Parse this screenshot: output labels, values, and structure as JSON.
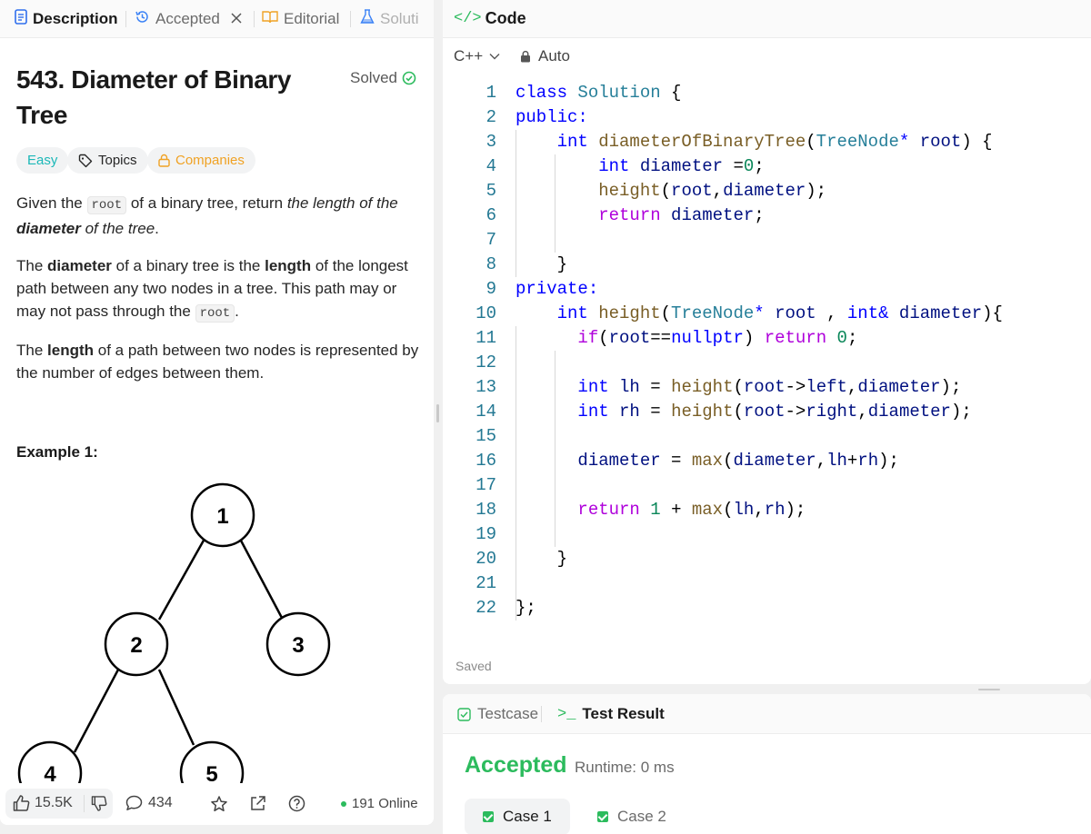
{
  "left_tabs": [
    {
      "label": "Description"
    },
    {
      "label": "Accepted"
    },
    {
      "label": "Editorial"
    },
    {
      "label": "Soluti"
    }
  ],
  "problem": {
    "title": "543. Diameter of Binary Tree",
    "status": "Solved",
    "chips": {
      "difficulty": "Easy",
      "topics": "Topics",
      "companies": "Companies"
    },
    "para1": {
      "t1": "Given the ",
      "code": "root",
      "t2": " of a binary tree, return ",
      "i1": "the length of the ",
      "bi": "diameter",
      "i2": " of the tree",
      "t3": "."
    },
    "para2": {
      "t1": "The ",
      "b1": "diameter",
      "t2": " of a binary tree is the ",
      "b2": "length",
      "t3": " of the longest path between any two nodes in a tree. This path may or may not pass through the ",
      "code": "root",
      "t4": "."
    },
    "para3": {
      "t1": "The ",
      "b1": "length",
      "t2": " of a path between two nodes is represented by the number of edges between them."
    },
    "example_title": "Example 1:",
    "tree_nodes": [
      "1",
      "2",
      "3",
      "4",
      "5"
    ]
  },
  "bottom_bar": {
    "likes": "15.5K",
    "comments": "434",
    "online": "191 Online"
  },
  "code_panel": {
    "title": "Code",
    "language": "C++",
    "mode": "Auto",
    "status": "Saved",
    "line_numbers": [
      "1",
      "2",
      "3",
      "4",
      "5",
      "6",
      "7",
      "8",
      "9",
      "10",
      "11",
      "12",
      "13",
      "14",
      "15",
      "16",
      "17",
      "18",
      "19",
      "20",
      "21",
      "22"
    ],
    "lines": [
      [
        [
          "k-blue",
          "class "
        ],
        [
          "k-type",
          "Solution"
        ],
        [
          "k-plain",
          " {"
        ]
      ],
      [
        [
          "k-blue",
          "public:"
        ]
      ],
      [
        [
          "k-plain",
          "    "
        ],
        [
          "k-blue",
          "int "
        ],
        [
          "k-fn",
          "diameterOfBinaryTree"
        ],
        [
          "k-plain",
          "("
        ],
        [
          "k-type",
          "TreeNode"
        ],
        [
          "k-blue",
          "* "
        ],
        [
          "k-var",
          "root"
        ],
        [
          "k-plain",
          ") {"
        ]
      ],
      [
        [
          "k-plain",
          "        "
        ],
        [
          "k-blue",
          "int "
        ],
        [
          "k-var",
          "diameter "
        ],
        [
          "k-plain",
          "="
        ],
        [
          "k-num",
          "0"
        ],
        [
          "k-plain",
          ";"
        ]
      ],
      [
        [
          "k-plain",
          "        "
        ],
        [
          "k-fn",
          "height"
        ],
        [
          "k-plain",
          "("
        ],
        [
          "k-var",
          "root"
        ],
        [
          "k-plain",
          ","
        ],
        [
          "k-var",
          "diameter"
        ],
        [
          "k-plain",
          ");"
        ]
      ],
      [
        [
          "k-plain",
          "        "
        ],
        [
          "k-purple",
          "return "
        ],
        [
          "k-var",
          "diameter"
        ],
        [
          "k-plain",
          ";"
        ]
      ],
      [],
      [
        [
          "k-plain",
          "    }"
        ]
      ],
      [
        [
          "k-blue",
          "private:"
        ]
      ],
      [
        [
          "k-plain",
          "    "
        ],
        [
          "k-blue",
          "int "
        ],
        [
          "k-fn",
          "height"
        ],
        [
          "k-plain",
          "("
        ],
        [
          "k-type",
          "TreeNode"
        ],
        [
          "k-blue",
          "* "
        ],
        [
          "k-var",
          "root "
        ],
        [
          "k-plain",
          ", "
        ],
        [
          "k-blue",
          "int& "
        ],
        [
          "k-var",
          "diameter"
        ],
        [
          "k-plain",
          "){"
        ]
      ],
      [
        [
          "k-plain",
          "      "
        ],
        [
          "k-purple",
          "if"
        ],
        [
          "k-plain",
          "("
        ],
        [
          "k-var",
          "root"
        ],
        [
          "k-plain",
          "=="
        ],
        [
          "k-blue",
          "nullptr"
        ],
        [
          "k-plain",
          ") "
        ],
        [
          "k-purple",
          "return "
        ],
        [
          "k-num",
          "0"
        ],
        [
          "k-plain",
          ";"
        ]
      ],
      [],
      [
        [
          "k-plain",
          "      "
        ],
        [
          "k-blue",
          "int "
        ],
        [
          "k-var",
          "lh "
        ],
        [
          "k-plain",
          "= "
        ],
        [
          "k-fn",
          "height"
        ],
        [
          "k-plain",
          "("
        ],
        [
          "k-var",
          "root"
        ],
        [
          "k-plain",
          "->"
        ],
        [
          "k-var",
          "left"
        ],
        [
          "k-plain",
          ","
        ],
        [
          "k-var",
          "diameter"
        ],
        [
          "k-plain",
          ");"
        ]
      ],
      [
        [
          "k-plain",
          "      "
        ],
        [
          "k-blue",
          "int "
        ],
        [
          "k-var",
          "rh "
        ],
        [
          "k-plain",
          "= "
        ],
        [
          "k-fn",
          "height"
        ],
        [
          "k-plain",
          "("
        ],
        [
          "k-var",
          "root"
        ],
        [
          "k-plain",
          "->"
        ],
        [
          "k-var",
          "right"
        ],
        [
          "k-plain",
          ","
        ],
        [
          "k-var",
          "diameter"
        ],
        [
          "k-plain",
          ");"
        ]
      ],
      [],
      [
        [
          "k-plain",
          "      "
        ],
        [
          "k-var",
          "diameter "
        ],
        [
          "k-plain",
          "= "
        ],
        [
          "k-fn",
          "max"
        ],
        [
          "k-plain",
          "("
        ],
        [
          "k-var",
          "diameter"
        ],
        [
          "k-plain",
          ","
        ],
        [
          "k-var",
          "lh"
        ],
        [
          "k-plain",
          "+"
        ],
        [
          "k-var",
          "rh"
        ],
        [
          "k-plain",
          ");"
        ]
      ],
      [],
      [
        [
          "k-plain",
          "      "
        ],
        [
          "k-purple",
          "return "
        ],
        [
          "k-num",
          "1 "
        ],
        [
          "k-plain",
          "+ "
        ],
        [
          "k-fn",
          "max"
        ],
        [
          "k-plain",
          "("
        ],
        [
          "k-var",
          "lh"
        ],
        [
          "k-plain",
          ","
        ],
        [
          "k-var",
          "rh"
        ],
        [
          "k-plain",
          ");"
        ]
      ],
      [],
      [
        [
          "k-plain",
          "    }"
        ]
      ],
      [],
      [
        [
          "k-plain",
          "};"
        ]
      ]
    ]
  },
  "test_panel": {
    "tabs": [
      "Testcase",
      "Test Result"
    ],
    "result": "Accepted",
    "runtime": "Runtime: 0 ms",
    "cases": [
      "Case 1",
      "Case 2"
    ]
  },
  "colors": {
    "accent_green": "#2cbb5d",
    "easy": "#1cb8b8",
    "companies": "#f0a224"
  }
}
